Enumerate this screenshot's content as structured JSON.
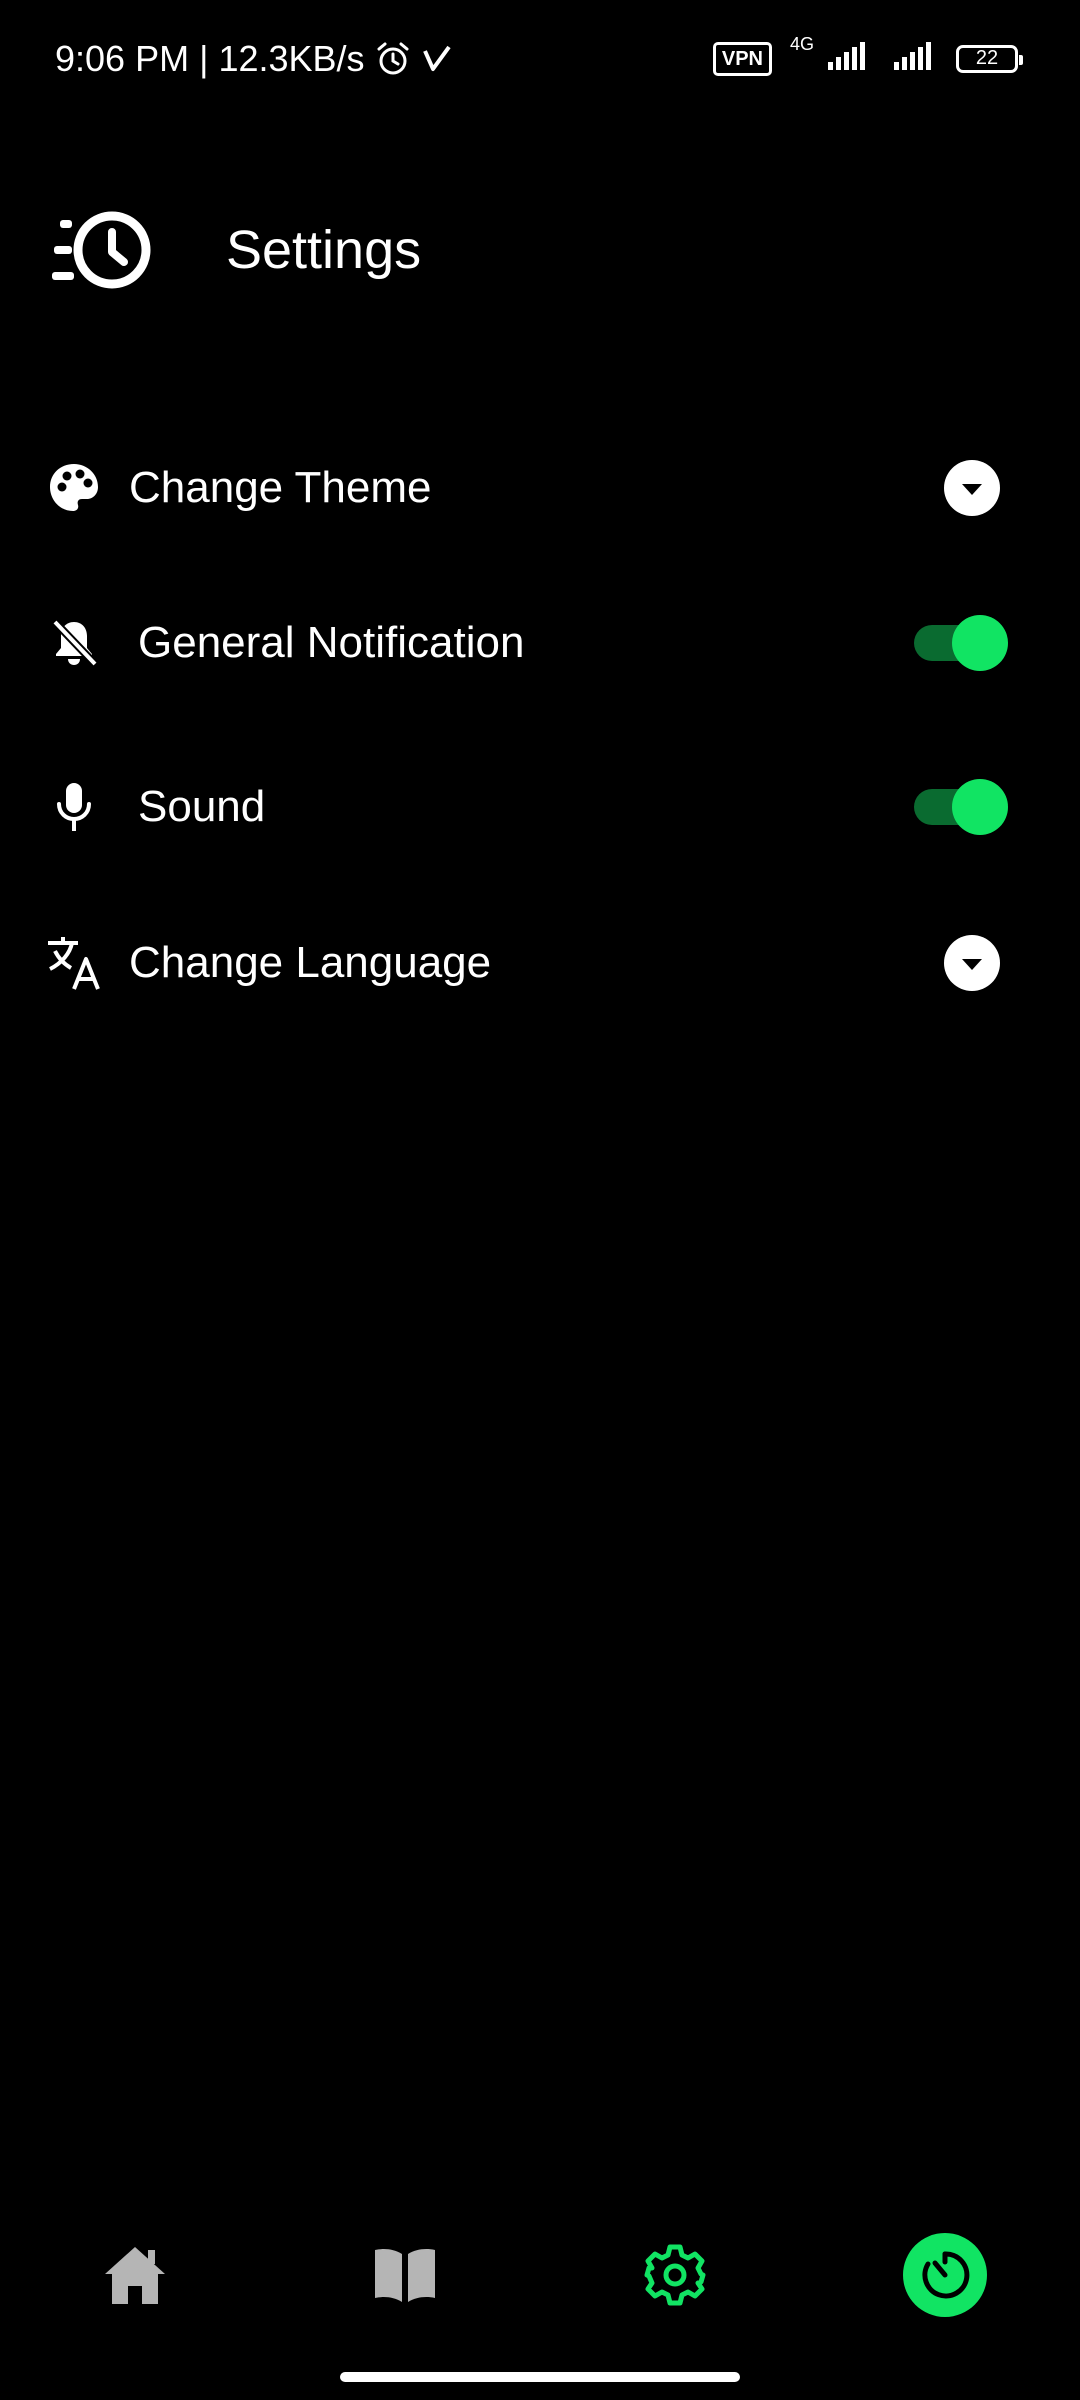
{
  "status_bar": {
    "time": "9:06 PM",
    "separator": "|",
    "speed": "12.3KB/s",
    "vpn": "VPN",
    "network": "4G",
    "battery": "22"
  },
  "header": {
    "title": "Settings",
    "icon": "fast-clock-icon"
  },
  "settings": {
    "items": [
      {
        "label": "Change Theme",
        "icon": "palette-icon",
        "control": "dropdown"
      },
      {
        "label": "General Notification",
        "icon": "bell-off-icon",
        "control": "toggle",
        "value": true
      },
      {
        "label": "Sound",
        "icon": "microphone-icon",
        "control": "toggle",
        "value": true
      },
      {
        "label": "Change Language",
        "icon": "translate-icon",
        "control": "dropdown"
      }
    ]
  },
  "bottom_nav": {
    "items": [
      {
        "name": "home",
        "icon": "home-icon",
        "active": false
      },
      {
        "name": "book",
        "icon": "book-icon",
        "active": false
      },
      {
        "name": "settings",
        "icon": "gear-icon",
        "active": true
      },
      {
        "name": "timer",
        "icon": "timer-icon",
        "active": false
      }
    ]
  },
  "colors": {
    "accent": "#11e463",
    "track_on": "#0a6b30",
    "background": "#000000",
    "text": "#ffffff",
    "nav_inactive": "#b5b5b5"
  }
}
